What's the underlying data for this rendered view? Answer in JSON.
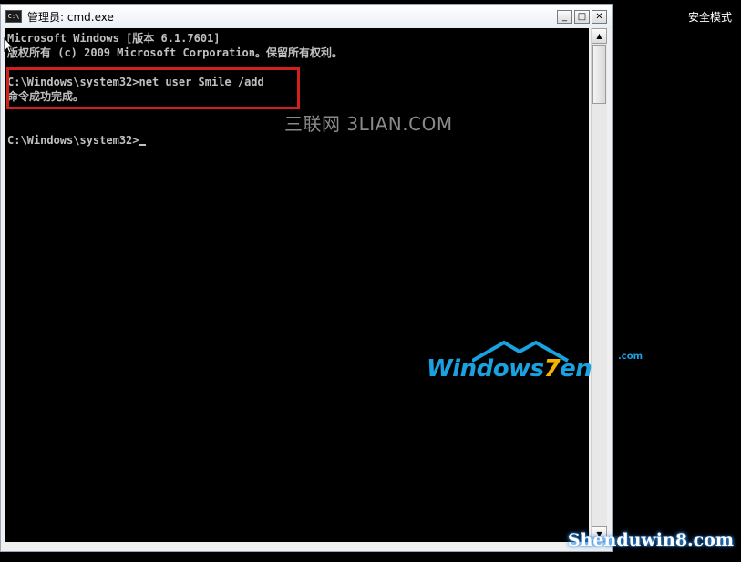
{
  "desktop": {
    "safe_mode_label": "安全模式",
    "safe_mode_label_bottom_left": "安全模式",
    "safe_mode_label_bottom_right": "安全模式"
  },
  "window": {
    "title": "管理员: cmd.exe",
    "icon_text": "C:\\",
    "buttons": {
      "minimize": "_",
      "maximize": "□",
      "close": "✕"
    }
  },
  "console": {
    "lines": [
      "Microsoft Windows [版本 6.1.7601]",
      "版权所有 (c) 2009 Microsoft Corporation。保留所有权利。",
      "",
      "C:\\Windows\\system32>net user Smile /add",
      "命令成功完成。",
      "",
      "",
      "C:\\Windows\\system32>"
    ]
  },
  "watermarks": {
    "sanlian": "三联网 3LIAN.COM",
    "windows7en_word": "Windows",
    "windows7en_seven": "7",
    "windows7en_tail": "en",
    "windows7en_com": ".com",
    "shenduwin": "Shenduwin8.com"
  },
  "colors": {
    "console_bg": "#000000",
    "console_text": "#c0c0c0",
    "highlight_border": "#d2201e",
    "logo_blue": "#1aa1e0",
    "logo_orange": "#f4b400"
  }
}
